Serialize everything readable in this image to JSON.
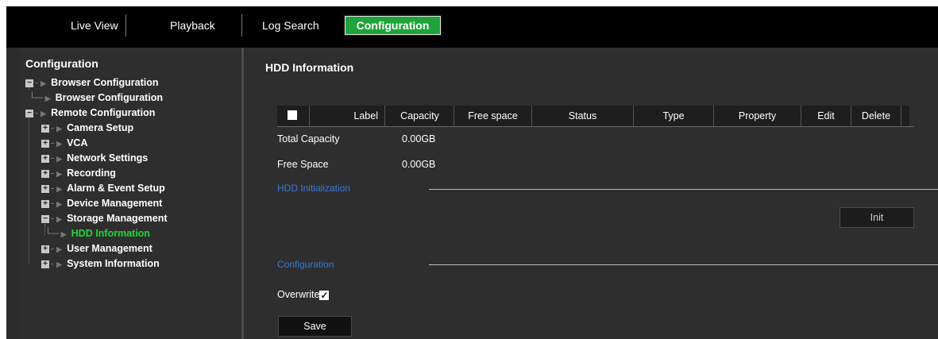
{
  "nav": {
    "tabs": [
      {
        "label": "Live View"
      },
      {
        "label": "Playback"
      },
      {
        "label": "Log Search"
      },
      {
        "label": "Configuration",
        "active": true
      }
    ]
  },
  "sidebar": {
    "title": "Configuration",
    "items": [
      {
        "label": "Browser Configuration",
        "expander": "minus"
      },
      {
        "label": "Browser Configuration"
      },
      {
        "label": "Remote Configuration",
        "expander": "minus"
      },
      {
        "label": "Camera Setup",
        "expander": "plus"
      },
      {
        "label": "VCA",
        "expander": "plus"
      },
      {
        "label": "Network Settings",
        "expander": "plus"
      },
      {
        "label": "Recording",
        "expander": "plus"
      },
      {
        "label": "Alarm & Event Setup",
        "expander": "plus"
      },
      {
        "label": "Device Management",
        "expander": "plus"
      },
      {
        "label": "Storage Management",
        "expander": "minus"
      },
      {
        "label": "HDD Information",
        "selected": true
      },
      {
        "label": "User Management",
        "expander": "plus"
      },
      {
        "label": "System Information",
        "expander": "plus"
      }
    ]
  },
  "main": {
    "title": "HDD Information",
    "table": {
      "columns": [
        "Label",
        "Capacity",
        "Free space",
        "Status",
        "Type",
        "Property",
        "Edit",
        "Delete"
      ],
      "rows": []
    },
    "total_capacity_label": "Total Capacity",
    "total_capacity_value": "0.00GB",
    "free_space_label": "Free Space",
    "free_space_value": "0.00GB",
    "hdd_init_section": "HDD Initialization",
    "init_button": "Init",
    "config_section": "Configuration",
    "overwrite_label": "Overwrite",
    "overwrite_checked": true,
    "save_button": "Save"
  },
  "colors": {
    "active_tab": "#1fa33b",
    "selected_tree_item": "#27d43c",
    "section_heading": "#3c78d8",
    "panel_bg": "#2e2e2e"
  }
}
